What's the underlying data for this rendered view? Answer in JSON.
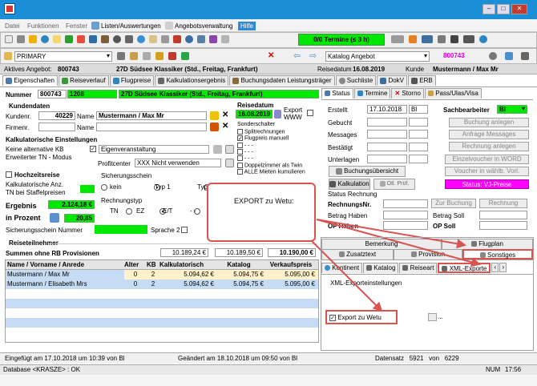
{
  "menu": [
    "Datei",
    "Funktionen",
    "Fenster",
    "Listen/Auswertungen",
    "Angebotsverwaltung",
    "Hilfe"
  ],
  "termine": "0/0 Termine (≤ 3 h)",
  "toolbar2": {
    "primary": "PRIMARY",
    "katalog": "Katalog Angebot",
    "code": "800743"
  },
  "infobar": {
    "aktives_label": "Aktives Angebot:",
    "aktives_value": "800743",
    "trip": "27D Südsee Klassiker (Std., Freitag, Frankfurt)",
    "reisedatum_label": "Reisedatum",
    "reisedatum_value": "16.08.2019",
    "kunde_label": "Kunde",
    "kunde_value": "Mustermann / Max Mr"
  },
  "tabs": [
    "Eigenschaften",
    "Reiseverlauf",
    "Flugpreise",
    "Kalkulationsergebnis",
    "Buchungsdaten Leistungsträger",
    "Suchliste",
    "DokV",
    "ERB"
  ],
  "left": {
    "nummer_label": "Nummer",
    "nummer": "800743",
    "nummer2": "1208",
    "trip": "27D Südsee Klassiker (Std., Freitag, Frankfurt)",
    "kundendaten": "Kundendaten",
    "kundennr_label": "Kundenr.",
    "kundennr": "40229",
    "name_label": "Name",
    "name": "Mustermann / Max Mr",
    "firmennr_label": "Firmenr.",
    "name2_label": "Name",
    "reisedatum_label": "Reisedatum",
    "reisedatum": "16.08.2019",
    "export": "Export WWW",
    "kalk_header": "Kalkulatorische Einstellungen",
    "keine_kb": "Keine alternative KB",
    "erweitert": "Erweiterter TN - Modus",
    "eigenveranstaltung": "Eigenveranstaltung",
    "profitcenter_label": "Profitcenter",
    "profitcenter": "XXX Nicht verwenden",
    "sonderschalter": "Sonderschalter",
    "splitrechnungen": "Splitrechnungen",
    "flugpreis_manuell": "Flugpreis manuell",
    "doppelzimmer": "Doppelzimmer als Twin",
    "alle_mieten": "ALLE Mieten kumulieren",
    "hochzeitsreise": "Hochzeitsreise",
    "kalk_anz": "Kalkulatorische Anz.",
    "tn_staffel": "TN bei Staffelpreisen",
    "sicherungsschein": "Sicherungsschein",
    "kein": "kein",
    "typ1": "Typ 1",
    "typ": "Typ",
    "rechnungstyp": "Rechnungstyp",
    "tn": "TN",
    "ez": "EZ",
    "et": "E/T",
    "ergebnis_label": "Ergebnis",
    "ergebnis": "2.124,18 €",
    "prozent_label": "in Prozent",
    "prozent": "20,85",
    "sicherungsnummer_label": "Sicherungsschein Nummer",
    "sprache_label": "Sprache 2"
  },
  "status_tabs": [
    "Status",
    "Termine",
    "Storno",
    "Pass/Ulas/Visa"
  ],
  "status": {
    "erstellt_label": "Erstellt",
    "erstellt": "17.10.2018",
    "erstellt_by": "Bl",
    "gebucht_label": "Gebucht",
    "messages_label": "Messages",
    "bestaetigt_label": "Bestätigt",
    "unterlagen_label": "Unterlagen",
    "buchungsuebersicht": "Buchungsübersicht",
    "kalkulation": "Kalkulation",
    "otl_pruef": "Otl. Prüf.",
    "sachbearbeiter_label": "Sachbearbeiter",
    "sachbearbeiter": "Bl",
    "buchung_anlegen": "Buchung anlegen",
    "anfrage": "Anfrage Messages",
    "rechnung_anlegen": "Rechnung anlegen",
    "einzelvoucher": "Einzelvoucher in WORD",
    "voucher_vorl": "Voucher in wählb. Vorl.",
    "status_vj": "Status: VJ-Preise",
    "status_rechnung": "Status Rechnung",
    "rechnungsnr": "RechnungsNr.",
    "zur_buchung": "Zur Buchung",
    "rechnung": "Rechnung",
    "betrag_haben": "Betrag Haben",
    "betrag_soll": "Betrag Soll",
    "op_haben": "OP Haben",
    "op_soll": "OP Soll"
  },
  "lower_tabs_r1": [
    "Bemerkung",
    "Flugplan"
  ],
  "lower_tabs_r2": [
    "Zusatztext",
    "Provision",
    "Sonstiges"
  ],
  "sub_tabs": [
    "Kontinent",
    "Katalog",
    "Reiseart",
    "XML-Exporte"
  ],
  "xml": {
    "header": "XML-Exporteinstellungen",
    "export_wetu": "Export zu Wetu"
  },
  "callout": "EXPORT zu Wetu:",
  "reiseteilnehmer": {
    "title": "Reiseteilnehmer",
    "summen_label": "Summen ohne RB Provisionen",
    "summe_kalk": "10.189,24 €",
    "summe_katalog": "10.189,50 €",
    "summe_vk": "10.190,00 €",
    "headers": [
      "Name / Vorname / Anrede",
      "Alter",
      "KB",
      "Kalkulatorisch",
      "Katalog",
      "Verkaufspreis"
    ],
    "rows": [
      [
        "Mustermann / Max Mr",
        "0",
        "2",
        "5.094,62 €",
        "5.094,75 €",
        "5.095,00 €"
      ],
      [
        "Mustermann / Elisabeth Mrs",
        "0",
        "2",
        "5.094,62 €",
        "5.094,75 €",
        "5.095,00 €"
      ]
    ]
  },
  "footer": {
    "eingefuegt": "Eingefügt am 17.10.2018 um 10:39 von Bl",
    "geaendert": "Geändert am 18.10.2018 um 09:50 von Bl",
    "datensatz": "Datensatz   5921   von   6229"
  },
  "statusbar": {
    "left": "Database <KRASZE> : OK",
    "num": "NUM",
    "time": "17:56"
  },
  "colors": {
    "titlebar": "#1a8fd8",
    "green": "#00e800",
    "magenta": "#ff00ff",
    "callout": "#d9534f",
    "rowsel": "#fff1c9",
    "rowblue": "#c6dcf5"
  }
}
